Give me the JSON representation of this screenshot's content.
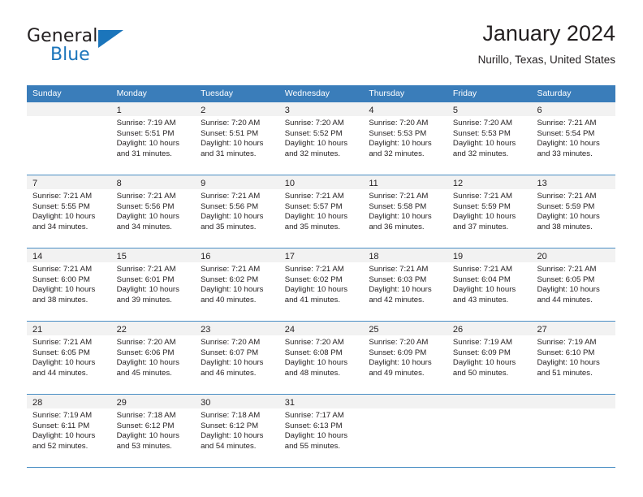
{
  "logo": {
    "word1": "General",
    "word2": "Blue",
    "triangle_color": "#1b75bb"
  },
  "header": {
    "title": "January 2024",
    "subtitle": "Nurillo, Texas, United States"
  },
  "colors": {
    "header_band": "#3a7dba",
    "day_band": "#f2f2f2",
    "row_divider": "#4a8ec4",
    "text": "#231f20"
  },
  "weekdays": [
    "Sunday",
    "Monday",
    "Tuesday",
    "Wednesday",
    "Thursday",
    "Friday",
    "Saturday"
  ],
  "weeks": [
    [
      {
        "day": "",
        "empty": true,
        "sunrise": "",
        "sunset": "",
        "daylight1": "",
        "daylight2": ""
      },
      {
        "day": "1",
        "sunrise": "Sunrise: 7:19 AM",
        "sunset": "Sunset: 5:51 PM",
        "daylight1": "Daylight: 10 hours",
        "daylight2": "and 31 minutes."
      },
      {
        "day": "2",
        "sunrise": "Sunrise: 7:20 AM",
        "sunset": "Sunset: 5:51 PM",
        "daylight1": "Daylight: 10 hours",
        "daylight2": "and 31 minutes."
      },
      {
        "day": "3",
        "sunrise": "Sunrise: 7:20 AM",
        "sunset": "Sunset: 5:52 PM",
        "daylight1": "Daylight: 10 hours",
        "daylight2": "and 32 minutes."
      },
      {
        "day": "4",
        "sunrise": "Sunrise: 7:20 AM",
        "sunset": "Sunset: 5:53 PM",
        "daylight1": "Daylight: 10 hours",
        "daylight2": "and 32 minutes."
      },
      {
        "day": "5",
        "sunrise": "Sunrise: 7:20 AM",
        "sunset": "Sunset: 5:53 PM",
        "daylight1": "Daylight: 10 hours",
        "daylight2": "and 32 minutes."
      },
      {
        "day": "6",
        "sunrise": "Sunrise: 7:21 AM",
        "sunset": "Sunset: 5:54 PM",
        "daylight1": "Daylight: 10 hours",
        "daylight2": "and 33 minutes."
      }
    ],
    [
      {
        "day": "7",
        "sunrise": "Sunrise: 7:21 AM",
        "sunset": "Sunset: 5:55 PM",
        "daylight1": "Daylight: 10 hours",
        "daylight2": "and 34 minutes."
      },
      {
        "day": "8",
        "sunrise": "Sunrise: 7:21 AM",
        "sunset": "Sunset: 5:56 PM",
        "daylight1": "Daylight: 10 hours",
        "daylight2": "and 34 minutes."
      },
      {
        "day": "9",
        "sunrise": "Sunrise: 7:21 AM",
        "sunset": "Sunset: 5:56 PM",
        "daylight1": "Daylight: 10 hours",
        "daylight2": "and 35 minutes."
      },
      {
        "day": "10",
        "sunrise": "Sunrise: 7:21 AM",
        "sunset": "Sunset: 5:57 PM",
        "daylight1": "Daylight: 10 hours",
        "daylight2": "and 35 minutes."
      },
      {
        "day": "11",
        "sunrise": "Sunrise: 7:21 AM",
        "sunset": "Sunset: 5:58 PM",
        "daylight1": "Daylight: 10 hours",
        "daylight2": "and 36 minutes."
      },
      {
        "day": "12",
        "sunrise": "Sunrise: 7:21 AM",
        "sunset": "Sunset: 5:59 PM",
        "daylight1": "Daylight: 10 hours",
        "daylight2": "and 37 minutes."
      },
      {
        "day": "13",
        "sunrise": "Sunrise: 7:21 AM",
        "sunset": "Sunset: 5:59 PM",
        "daylight1": "Daylight: 10 hours",
        "daylight2": "and 38 minutes."
      }
    ],
    [
      {
        "day": "14",
        "sunrise": "Sunrise: 7:21 AM",
        "sunset": "Sunset: 6:00 PM",
        "daylight1": "Daylight: 10 hours",
        "daylight2": "and 38 minutes."
      },
      {
        "day": "15",
        "sunrise": "Sunrise: 7:21 AM",
        "sunset": "Sunset: 6:01 PM",
        "daylight1": "Daylight: 10 hours",
        "daylight2": "and 39 minutes."
      },
      {
        "day": "16",
        "sunrise": "Sunrise: 7:21 AM",
        "sunset": "Sunset: 6:02 PM",
        "daylight1": "Daylight: 10 hours",
        "daylight2": "and 40 minutes."
      },
      {
        "day": "17",
        "sunrise": "Sunrise: 7:21 AM",
        "sunset": "Sunset: 6:02 PM",
        "daylight1": "Daylight: 10 hours",
        "daylight2": "and 41 minutes."
      },
      {
        "day": "18",
        "sunrise": "Sunrise: 7:21 AM",
        "sunset": "Sunset: 6:03 PM",
        "daylight1": "Daylight: 10 hours",
        "daylight2": "and 42 minutes."
      },
      {
        "day": "19",
        "sunrise": "Sunrise: 7:21 AM",
        "sunset": "Sunset: 6:04 PM",
        "daylight1": "Daylight: 10 hours",
        "daylight2": "and 43 minutes."
      },
      {
        "day": "20",
        "sunrise": "Sunrise: 7:21 AM",
        "sunset": "Sunset: 6:05 PM",
        "daylight1": "Daylight: 10 hours",
        "daylight2": "and 44 minutes."
      }
    ],
    [
      {
        "day": "21",
        "sunrise": "Sunrise: 7:21 AM",
        "sunset": "Sunset: 6:05 PM",
        "daylight1": "Daylight: 10 hours",
        "daylight2": "and 44 minutes."
      },
      {
        "day": "22",
        "sunrise": "Sunrise: 7:20 AM",
        "sunset": "Sunset: 6:06 PM",
        "daylight1": "Daylight: 10 hours",
        "daylight2": "and 45 minutes."
      },
      {
        "day": "23",
        "sunrise": "Sunrise: 7:20 AM",
        "sunset": "Sunset: 6:07 PM",
        "daylight1": "Daylight: 10 hours",
        "daylight2": "and 46 minutes."
      },
      {
        "day": "24",
        "sunrise": "Sunrise: 7:20 AM",
        "sunset": "Sunset: 6:08 PM",
        "daylight1": "Daylight: 10 hours",
        "daylight2": "and 48 minutes."
      },
      {
        "day": "25",
        "sunrise": "Sunrise: 7:20 AM",
        "sunset": "Sunset: 6:09 PM",
        "daylight1": "Daylight: 10 hours",
        "daylight2": "and 49 minutes."
      },
      {
        "day": "26",
        "sunrise": "Sunrise: 7:19 AM",
        "sunset": "Sunset: 6:09 PM",
        "daylight1": "Daylight: 10 hours",
        "daylight2": "and 50 minutes."
      },
      {
        "day": "27",
        "sunrise": "Sunrise: 7:19 AM",
        "sunset": "Sunset: 6:10 PM",
        "daylight1": "Daylight: 10 hours",
        "daylight2": "and 51 minutes."
      }
    ],
    [
      {
        "day": "28",
        "sunrise": "Sunrise: 7:19 AM",
        "sunset": "Sunset: 6:11 PM",
        "daylight1": "Daylight: 10 hours",
        "daylight2": "and 52 minutes."
      },
      {
        "day": "29",
        "sunrise": "Sunrise: 7:18 AM",
        "sunset": "Sunset: 6:12 PM",
        "daylight1": "Daylight: 10 hours",
        "daylight2": "and 53 minutes."
      },
      {
        "day": "30",
        "sunrise": "Sunrise: 7:18 AM",
        "sunset": "Sunset: 6:12 PM",
        "daylight1": "Daylight: 10 hours",
        "daylight2": "and 54 minutes."
      },
      {
        "day": "31",
        "sunrise": "Sunrise: 7:17 AM",
        "sunset": "Sunset: 6:13 PM",
        "daylight1": "Daylight: 10 hours",
        "daylight2": "and 55 minutes."
      },
      {
        "day": "",
        "empty": true,
        "sunrise": "",
        "sunset": "",
        "daylight1": "",
        "daylight2": ""
      },
      {
        "day": "",
        "empty": true,
        "sunrise": "",
        "sunset": "",
        "daylight1": "",
        "daylight2": ""
      },
      {
        "day": "",
        "empty": true,
        "sunrise": "",
        "sunset": "",
        "daylight1": "",
        "daylight2": ""
      }
    ]
  ]
}
